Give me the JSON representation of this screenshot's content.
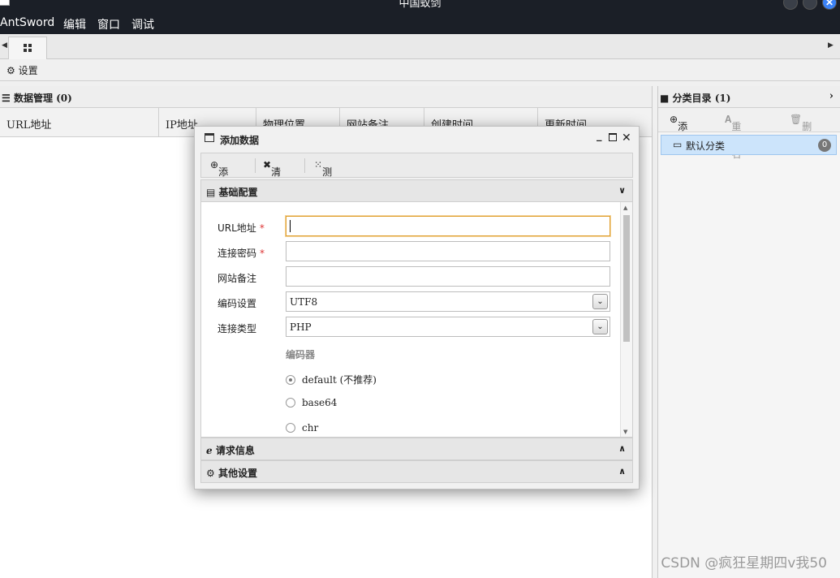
{
  "window": {
    "title": "中国蚁剑"
  },
  "menubar": {
    "items": [
      "AntSword",
      "编辑",
      "窗口",
      "调试"
    ]
  },
  "toolbar": {
    "settings_label": "设置"
  },
  "data_panel": {
    "title": "数据管理 (0)",
    "columns": [
      "URL地址",
      "IP地址",
      "物理位置",
      "网站备注",
      "创建时间",
      "更新时间"
    ]
  },
  "category_panel": {
    "title": "分类目录 (1)",
    "add_label": "添加",
    "rename_label": "重命名",
    "delete_label": "删除",
    "items": [
      {
        "label": "默认分类",
        "count": "0"
      }
    ]
  },
  "modal": {
    "title": "添加数据",
    "tools": {
      "add": "添加",
      "clear": "清空",
      "test": "测试连接"
    },
    "sections": {
      "basic": "基础配置",
      "request": "请求信息",
      "other": "其他设置"
    },
    "form": {
      "url_label": "URL地址",
      "password_label": "连接密码",
      "note_label": "网站备注",
      "encoding_label": "编码设置",
      "encoding_value": "UTF8",
      "type_label": "连接类型",
      "type_value": "PHP",
      "encoder_label": "编码器",
      "encoders": [
        "default (不推荐)",
        "base64",
        "chr"
      ],
      "required_mark": "*"
    }
  },
  "watermark": "CSDN @疯狂星期四v我50"
}
